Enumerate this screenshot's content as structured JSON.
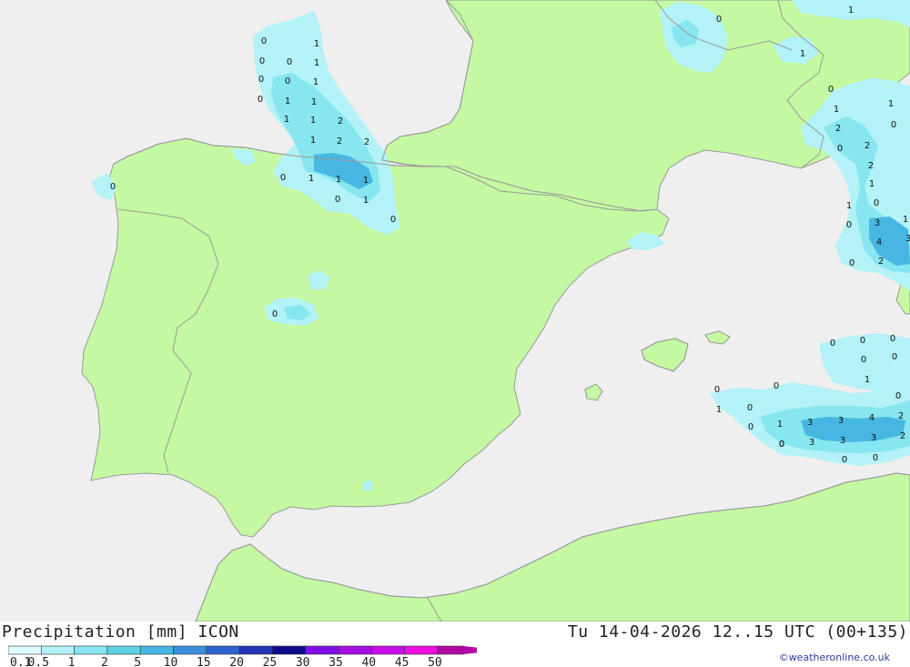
{
  "header": {
    "title": "Precipitation [mm] ICON",
    "validity": "Tu 14-04-2026 12..15 UTC (00+135)",
    "credit": "©weatheronline.co.uk"
  },
  "colors": {
    "sea": "#efefef",
    "land": "#c5f8a2",
    "border": "#999999"
  },
  "legend": {
    "labels": [
      "0.1",
      "0.5",
      "1",
      "2",
      "5",
      "10",
      "15",
      "20",
      "25",
      "30",
      "35",
      "40",
      "45",
      "50"
    ],
    "colors": [
      "#dcf9fc",
      "#b3f2f6",
      "#87e6ef",
      "#5fd3e6",
      "#47b7e2",
      "#3c8fdb",
      "#2f61d0",
      "#2235b6",
      "#0c0c8c",
      "#7d0fe6",
      "#a60ee6",
      "#c80ee8",
      "#ee0ee0",
      "#b40aa5"
    ]
  },
  "map_values": [
    {
      "v": "0"
    },
    {
      "v": "1"
    },
    {
      "v": "0"
    },
    {
      "v": "0"
    },
    {
      "v": "1"
    },
    {
      "v": "0"
    },
    {
      "v": "0"
    },
    {
      "v": "1"
    },
    {
      "v": "0"
    },
    {
      "v": "1"
    },
    {
      "v": "1"
    },
    {
      "v": "1"
    },
    {
      "v": "1"
    },
    {
      "v": "2"
    },
    {
      "v": "1"
    },
    {
      "v": "2"
    },
    {
      "v": "2"
    },
    {
      "v": "0"
    },
    {
      "v": "1"
    },
    {
      "v": "1"
    },
    {
      "v": "1"
    },
    {
      "v": "0"
    },
    {
      "v": "1"
    },
    {
      "v": "0"
    },
    {
      "v": "0"
    },
    {
      "v": "0"
    },
    {
      "v": "0"
    },
    {
      "v": "1"
    },
    {
      "v": "1"
    },
    {
      "v": "0"
    },
    {
      "v": "1"
    },
    {
      "v": "1"
    },
    {
      "v": "2"
    },
    {
      "v": "2"
    },
    {
      "v": "0"
    },
    {
      "v": "0"
    },
    {
      "v": "2"
    },
    {
      "v": "1"
    },
    {
      "v": "1"
    },
    {
      "v": "0"
    },
    {
      "v": "0"
    },
    {
      "v": "3"
    },
    {
      "v": "1"
    },
    {
      "v": "4"
    },
    {
      "v": "3"
    },
    {
      "v": "0"
    },
    {
      "v": "2"
    },
    {
      "v": "0"
    },
    {
      "v": "0"
    },
    {
      "v": "0"
    },
    {
      "v": "0"
    },
    {
      "v": "0"
    },
    {
      "v": "0"
    },
    {
      "v": "0"
    },
    {
      "v": "1"
    },
    {
      "v": "0"
    },
    {
      "v": "1"
    },
    {
      "v": "0"
    },
    {
      "v": "0"
    },
    {
      "v": "2"
    },
    {
      "v": "0"
    },
    {
      "v": "1"
    },
    {
      "v": "3"
    },
    {
      "v": "3"
    },
    {
      "v": "4"
    },
    {
      "v": "0"
    },
    {
      "v": "3"
    },
    {
      "v": "3"
    },
    {
      "v": "3"
    },
    {
      "v": "2"
    },
    {
      "v": "0"
    },
    {
      "v": "0"
    }
  ]
}
